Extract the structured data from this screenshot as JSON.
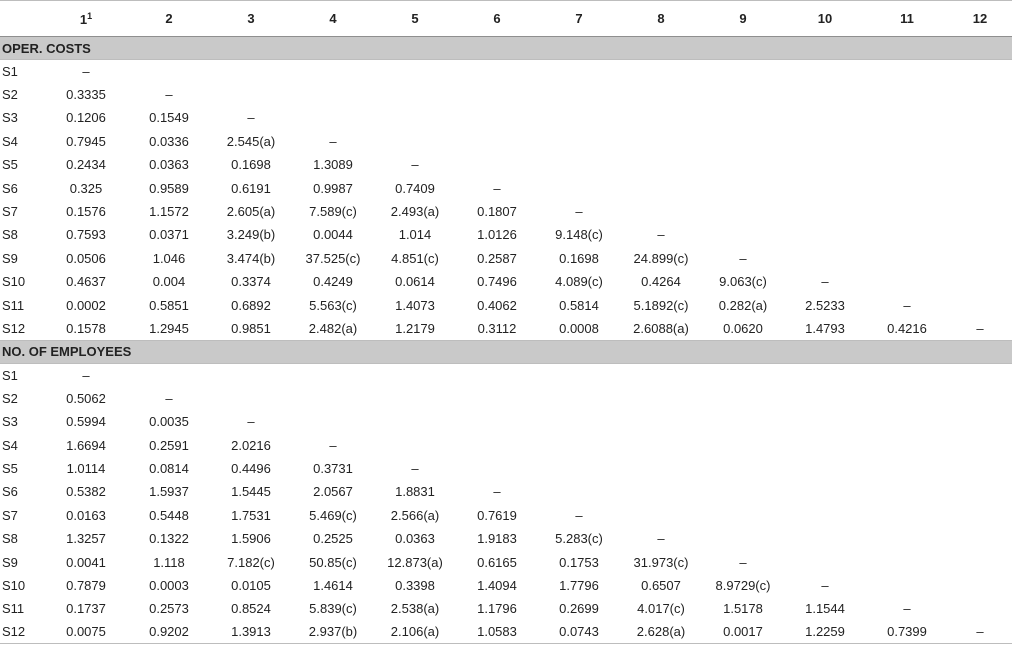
{
  "columns": [
    "1",
    "2",
    "3",
    "4",
    "5",
    "6",
    "7",
    "8",
    "9",
    "10",
    "11",
    "12"
  ],
  "first_col_footnote": "1",
  "sections": [
    {
      "title": "OPER. COSTS",
      "rows": [
        {
          "label": "S1",
          "cells": [
            "–"
          ]
        },
        {
          "label": "S2",
          "cells": [
            "0.3335",
            "–"
          ]
        },
        {
          "label": "S3",
          "cells": [
            "0.1206",
            "0.1549",
            "–"
          ]
        },
        {
          "label": "S4",
          "cells": [
            "0.7945",
            "0.0336",
            "2.545(a)",
            "–"
          ]
        },
        {
          "label": "S5",
          "cells": [
            "0.2434",
            "0.0363",
            "0.1698",
            "1.3089",
            "–"
          ]
        },
        {
          "label": "S6",
          "cells": [
            "0.325",
            "0.9589",
            "0.6191",
            "0.9987",
            "0.7409",
            "–"
          ]
        },
        {
          "label": "S7",
          "cells": [
            "0.1576",
            "1.1572",
            "2.605(a)",
            "7.589(c)",
            "2.493(a)",
            "0.1807",
            "–"
          ]
        },
        {
          "label": "S8",
          "cells": [
            "0.7593",
            "0.0371",
            "3.249(b)",
            "0.0044",
            "1.014",
            "1.0126",
            "9.148(c)",
            "–"
          ]
        },
        {
          "label": "S9",
          "cells": [
            "0.0506",
            "1.046",
            "3.474(b)",
            "37.525(c)",
            "4.851(c)",
            "0.2587",
            "0.1698",
            "24.899(c)",
            "–"
          ]
        },
        {
          "label": "S10",
          "cells": [
            "0.4637",
            "0.004",
            "0.3374",
            "0.4249",
            "0.0614",
            "0.7496",
            "4.089(c)",
            "0.4264",
            "9.063(c)",
            "–"
          ]
        },
        {
          "label": "S11",
          "cells": [
            "0.0002",
            "0.5851",
            "0.6892",
            "5.563(c)",
            "1.4073",
            "0.4062",
            "0.5814",
            "5.1892(c)",
            "0.282(a)",
            "2.5233",
            "–"
          ]
        },
        {
          "label": "S12",
          "cells": [
            "0.1578",
            "1.2945",
            "0.9851",
            "2.482(a)",
            "1.2179",
            "0.3112",
            "0.0008",
            "2.6088(a)",
            "0.0620",
            "1.4793",
            "0.4216",
            "–"
          ]
        }
      ]
    },
    {
      "title": "NO. OF EMPLOYEES",
      "rows": [
        {
          "label": "S1",
          "cells": [
            "–"
          ]
        },
        {
          "label": "S2",
          "cells": [
            "0.5062",
            "–"
          ]
        },
        {
          "label": "S3",
          "cells": [
            "0.5994",
            "0.0035",
            "–"
          ]
        },
        {
          "label": "S4",
          "cells": [
            "1.6694",
            "0.2591",
            "2.0216",
            "–"
          ]
        },
        {
          "label": "S5",
          "cells": [
            "1.0114",
            "0.0814",
            "0.4496",
            "0.3731",
            "–"
          ]
        },
        {
          "label": "S6",
          "cells": [
            "0.5382",
            "1.5937",
            "1.5445",
            "2.0567",
            "1.8831",
            "–"
          ]
        },
        {
          "label": "S7",
          "cells": [
            "0.0163",
            "0.5448",
            "1.7531",
            "5.469(c)",
            "2.566(a)",
            "0.7619",
            "–"
          ]
        },
        {
          "label": "S8",
          "cells": [
            "1.3257",
            "0.1322",
            "1.5906",
            "0.2525",
            "0.0363",
            "1.9183",
            "5.283(c)",
            "–"
          ]
        },
        {
          "label": "S9",
          "cells": [
            "0.0041",
            "1.118",
            "7.182(c)",
            "50.85(c)",
            "12.873(a)",
            "0.6165",
            "0.1753",
            "31.973(c)",
            "–"
          ]
        },
        {
          "label": "S10",
          "cells": [
            "0.7879",
            "0.0003",
            "0.0105",
            "1.4614",
            "0.3398",
            "1.4094",
            "1.7796",
            "0.6507",
            "8.9729(c)",
            "–"
          ]
        },
        {
          "label": "S11",
          "cells": [
            "0.1737",
            "0.2573",
            "0.8524",
            "5.839(c)",
            "2.538(a)",
            "1.1796",
            "0.2699",
            "4.017(c)",
            "1.5178",
            "1.1544",
            "–"
          ]
        },
        {
          "label": "S12",
          "cells": [
            "0.0075",
            "0.9202",
            "1.3913",
            "2.937(b)",
            "2.106(a)",
            "1.0583",
            "0.0743",
            "2.628(a)",
            "0.0017",
            "1.2259",
            "0.7399",
            "–"
          ]
        }
      ]
    }
  ]
}
